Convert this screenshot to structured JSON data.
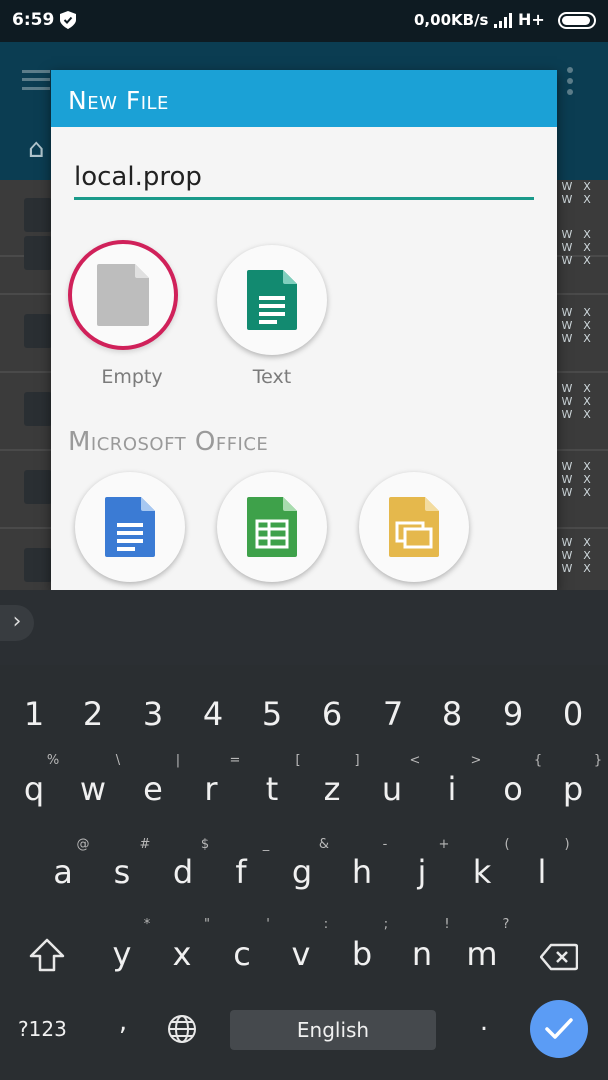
{
  "status_bar": {
    "time": "6:59",
    "network_speed": "0,00KB/s",
    "network_type": "H+",
    "icons": [
      "shield-icon",
      "signal-icon",
      "battery-icon"
    ]
  },
  "dialog": {
    "title": "New File",
    "filename_value": "local.prop",
    "templates": [
      {
        "label": "Empty",
        "icon": "blank-file-icon",
        "selected": true
      },
      {
        "label": "Text",
        "icon": "text-document-icon",
        "selected": false
      }
    ],
    "office_section_title": "Microsoft Office",
    "office_templates": [
      {
        "icon": "word-document-icon",
        "color": "#3b7bd4"
      },
      {
        "icon": "spreadsheet-icon",
        "color": "#3ea14a"
      },
      {
        "icon": "presentation-icon",
        "color": "#e5b84c"
      }
    ],
    "colors": {
      "header": "#1ba1d6",
      "accent_underline": "#1a9a8a",
      "selection_ring": "#d0215a"
    }
  },
  "background_list": {
    "perm_labels": [
      "W",
      "X"
    ]
  },
  "keyboard": {
    "number_row": [
      "1",
      "2",
      "3",
      "4",
      "5",
      "6",
      "7",
      "8",
      "9",
      "0"
    ],
    "row1": [
      "q",
      "w",
      "e",
      "r",
      "t",
      "z",
      "u",
      "i",
      "o",
      "p"
    ],
    "row1_hints": [
      "%",
      "\\",
      "|",
      "=",
      "[",
      "]",
      "<",
      ">",
      "{",
      "}"
    ],
    "row2": [
      "a",
      "s",
      "d",
      "f",
      "g",
      "h",
      "j",
      "k",
      "l"
    ],
    "row2_hints": [
      "@",
      "#",
      "$",
      "_",
      "&",
      "-",
      "+",
      "(",
      ")"
    ],
    "row3": [
      "y",
      "x",
      "c",
      "v",
      "b",
      "n",
      "m"
    ],
    "row3_hints": [
      "*",
      "\"",
      "'",
      ":",
      ";",
      "!",
      "?"
    ],
    "symbols_label": "?123",
    "comma": ",",
    "space_label": "English",
    "period": "."
  }
}
